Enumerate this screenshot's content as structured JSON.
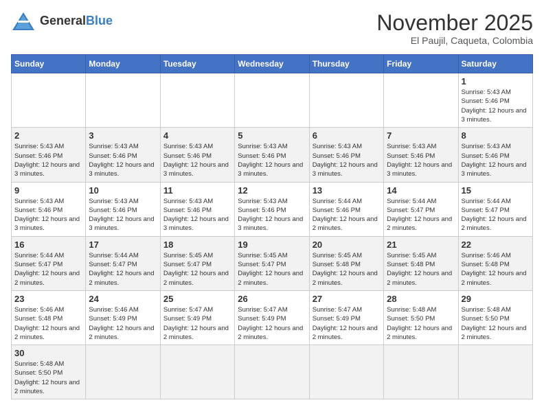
{
  "header": {
    "logo_general": "General",
    "logo_blue": "Blue",
    "month_title": "November 2025",
    "location": "El Paujil, Caqueta, Colombia"
  },
  "weekdays": [
    "Sunday",
    "Monday",
    "Tuesday",
    "Wednesday",
    "Thursday",
    "Friday",
    "Saturday"
  ],
  "weeks": [
    [
      {
        "day": "",
        "info": ""
      },
      {
        "day": "",
        "info": ""
      },
      {
        "day": "",
        "info": ""
      },
      {
        "day": "",
        "info": ""
      },
      {
        "day": "",
        "info": ""
      },
      {
        "day": "",
        "info": ""
      },
      {
        "day": "1",
        "info": "Sunrise: 5:43 AM\nSunset: 5:46 PM\nDaylight: 12 hours and 3 minutes."
      }
    ],
    [
      {
        "day": "2",
        "info": "Sunrise: 5:43 AM\nSunset: 5:46 PM\nDaylight: 12 hours and 3 minutes."
      },
      {
        "day": "3",
        "info": "Sunrise: 5:43 AM\nSunset: 5:46 PM\nDaylight: 12 hours and 3 minutes."
      },
      {
        "day": "4",
        "info": "Sunrise: 5:43 AM\nSunset: 5:46 PM\nDaylight: 12 hours and 3 minutes."
      },
      {
        "day": "5",
        "info": "Sunrise: 5:43 AM\nSunset: 5:46 PM\nDaylight: 12 hours and 3 minutes."
      },
      {
        "day": "6",
        "info": "Sunrise: 5:43 AM\nSunset: 5:46 PM\nDaylight: 12 hours and 3 minutes."
      },
      {
        "day": "7",
        "info": "Sunrise: 5:43 AM\nSunset: 5:46 PM\nDaylight: 12 hours and 3 minutes."
      },
      {
        "day": "8",
        "info": "Sunrise: 5:43 AM\nSunset: 5:46 PM\nDaylight: 12 hours and 3 minutes."
      }
    ],
    [
      {
        "day": "9",
        "info": "Sunrise: 5:43 AM\nSunset: 5:46 PM\nDaylight: 12 hours and 3 minutes."
      },
      {
        "day": "10",
        "info": "Sunrise: 5:43 AM\nSunset: 5:46 PM\nDaylight: 12 hours and 3 minutes."
      },
      {
        "day": "11",
        "info": "Sunrise: 5:43 AM\nSunset: 5:46 PM\nDaylight: 12 hours and 3 minutes."
      },
      {
        "day": "12",
        "info": "Sunrise: 5:43 AM\nSunset: 5:46 PM\nDaylight: 12 hours and 3 minutes."
      },
      {
        "day": "13",
        "info": "Sunrise: 5:44 AM\nSunset: 5:46 PM\nDaylight: 12 hours and 2 minutes."
      },
      {
        "day": "14",
        "info": "Sunrise: 5:44 AM\nSunset: 5:47 PM\nDaylight: 12 hours and 2 minutes."
      },
      {
        "day": "15",
        "info": "Sunrise: 5:44 AM\nSunset: 5:47 PM\nDaylight: 12 hours and 2 minutes."
      }
    ],
    [
      {
        "day": "16",
        "info": "Sunrise: 5:44 AM\nSunset: 5:47 PM\nDaylight: 12 hours and 2 minutes."
      },
      {
        "day": "17",
        "info": "Sunrise: 5:44 AM\nSunset: 5:47 PM\nDaylight: 12 hours and 2 minutes."
      },
      {
        "day": "18",
        "info": "Sunrise: 5:45 AM\nSunset: 5:47 PM\nDaylight: 12 hours and 2 minutes."
      },
      {
        "day": "19",
        "info": "Sunrise: 5:45 AM\nSunset: 5:47 PM\nDaylight: 12 hours and 2 minutes."
      },
      {
        "day": "20",
        "info": "Sunrise: 5:45 AM\nSunset: 5:48 PM\nDaylight: 12 hours and 2 minutes."
      },
      {
        "day": "21",
        "info": "Sunrise: 5:45 AM\nSunset: 5:48 PM\nDaylight: 12 hours and 2 minutes."
      },
      {
        "day": "22",
        "info": "Sunrise: 5:46 AM\nSunset: 5:48 PM\nDaylight: 12 hours and 2 minutes."
      }
    ],
    [
      {
        "day": "23",
        "info": "Sunrise: 5:46 AM\nSunset: 5:48 PM\nDaylight: 12 hours and 2 minutes."
      },
      {
        "day": "24",
        "info": "Sunrise: 5:46 AM\nSunset: 5:49 PM\nDaylight: 12 hours and 2 minutes."
      },
      {
        "day": "25",
        "info": "Sunrise: 5:47 AM\nSunset: 5:49 PM\nDaylight: 12 hours and 2 minutes."
      },
      {
        "day": "26",
        "info": "Sunrise: 5:47 AM\nSunset: 5:49 PM\nDaylight: 12 hours and 2 minutes."
      },
      {
        "day": "27",
        "info": "Sunrise: 5:47 AM\nSunset: 5:49 PM\nDaylight: 12 hours and 2 minutes."
      },
      {
        "day": "28",
        "info": "Sunrise: 5:48 AM\nSunset: 5:50 PM\nDaylight: 12 hours and 2 minutes."
      },
      {
        "day": "29",
        "info": "Sunrise: 5:48 AM\nSunset: 5:50 PM\nDaylight: 12 hours and 2 minutes."
      }
    ],
    [
      {
        "day": "30",
        "info": "Sunrise: 5:48 AM\nSunset: 5:50 PM\nDaylight: 12 hours and 2 minutes."
      },
      {
        "day": "",
        "info": ""
      },
      {
        "day": "",
        "info": ""
      },
      {
        "day": "",
        "info": ""
      },
      {
        "day": "",
        "info": ""
      },
      {
        "day": "",
        "info": ""
      },
      {
        "day": "",
        "info": ""
      }
    ]
  ]
}
